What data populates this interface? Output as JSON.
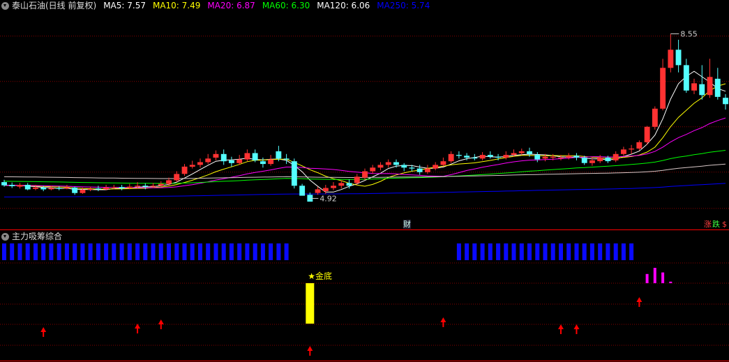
{
  "header": {
    "title": "泰山石油(日线 前复权)",
    "ma": [
      {
        "label": "MA5: 7.57",
        "color": "#ffffff"
      },
      {
        "label": "MA10: 7.49",
        "color": "#ffff00"
      },
      {
        "label": "MA20: 6.87",
        "color": "#ff00ff"
      },
      {
        "label": "MA60: 6.30",
        "color": "#00ff00"
      },
      {
        "label": "MA120: 6.06",
        "color": "#ffffff"
      },
      {
        "label": "MA250: 5.74",
        "color": "#0000ff"
      }
    ]
  },
  "indicator": {
    "title": "主力吸筹综合",
    "signal_label": "★金底"
  },
  "badges": {
    "cai": "财",
    "zhang": "涨",
    "die": "跌",
    "dollar": "$"
  },
  "colors": {
    "up": "#ff3232",
    "down": "#54ffff",
    "grid": "#880000",
    "axis": "#ff0000",
    "blue_bar": "#0a0aff",
    "signal": "#ffff00",
    "magenta": "#ff00ff",
    "arrow": "#ff0000"
  },
  "chart_data": [
    {
      "type": "candlestick",
      "title": "泰山石油(日线 前复权)",
      "price_range": [
        4.45,
        9.05
      ],
      "price_gridlines": [
        8.5,
        7.5,
        6.5,
        5.5,
        4.7
      ],
      "high_label": "8.55",
      "low_label": "4.92",
      "candles": [
        [
          5.28,
          5.21,
          5.33,
          5.18
        ],
        [
          5.22,
          5.19,
          5.27,
          5.15
        ],
        [
          5.18,
          5.22,
          5.26,
          5.14
        ],
        [
          5.22,
          5.12,
          5.26,
          5.1
        ],
        [
          5.13,
          5.16,
          5.22,
          5.1
        ],
        [
          5.16,
          5.12,
          5.2,
          5.08
        ],
        [
          5.12,
          5.15,
          5.2,
          5.1
        ],
        [
          5.15,
          5.13,
          5.19,
          5.1
        ],
        [
          5.14,
          5.16,
          5.22,
          5.12
        ],
        [
          5.16,
          5.04,
          5.18,
          5.0
        ],
        [
          5.04,
          5.11,
          5.16,
          5.02
        ],
        [
          5.11,
          5.13,
          5.18,
          5.08
        ],
        [
          5.14,
          5.12,
          5.2,
          5.08
        ],
        [
          5.12,
          5.16,
          5.22,
          5.1
        ],
        [
          5.16,
          5.17,
          5.22,
          5.12
        ],
        [
          5.17,
          5.14,
          5.22,
          5.1
        ],
        [
          5.15,
          5.18,
          5.24,
          5.12
        ],
        [
          5.18,
          5.2,
          5.28,
          5.14
        ],
        [
          5.2,
          5.18,
          5.25,
          5.12
        ],
        [
          5.18,
          5.2,
          5.26,
          5.15
        ],
        [
          5.2,
          5.24,
          5.3,
          5.17
        ],
        [
          5.24,
          5.32,
          5.38,
          5.2
        ],
        [
          5.32,
          5.46,
          5.52,
          5.28
        ],
        [
          5.46,
          5.62,
          5.68,
          5.42
        ],
        [
          5.62,
          5.66,
          5.75,
          5.58
        ],
        [
          5.66,
          5.72,
          5.8,
          5.6
        ],
        [
          5.72,
          5.8,
          5.9,
          5.68
        ],
        [
          5.82,
          5.9,
          5.98,
          5.76
        ],
        [
          5.9,
          5.74,
          6.0,
          5.66
        ],
        [
          5.76,
          5.7,
          5.84,
          5.62
        ],
        [
          5.7,
          5.78,
          5.88,
          5.66
        ],
        [
          5.78,
          5.92,
          6.0,
          5.74
        ],
        [
          5.92,
          5.76,
          6.0,
          5.72
        ],
        [
          5.74,
          5.68,
          5.82,
          5.6
        ],
        [
          5.68,
          5.78,
          5.88,
          5.64
        ],
        [
          5.96,
          5.8,
          6.08,
          5.74
        ],
        [
          5.8,
          5.78,
          5.9,
          5.68
        ],
        [
          5.74,
          5.2,
          5.8,
          5.14
        ],
        [
          5.2,
          4.98,
          5.24,
          5.0
        ],
        [
          5.0,
          4.85,
          5.05,
          4.92
        ],
        [
          5.04,
          5.12,
          5.18,
          5.0
        ],
        [
          5.08,
          5.15,
          5.22,
          5.02
        ],
        [
          5.15,
          5.2,
          5.28,
          5.1
        ],
        [
          5.2,
          5.26,
          5.32,
          5.14
        ],
        [
          5.26,
          5.2,
          5.34,
          5.14
        ],
        [
          5.26,
          5.4,
          5.46,
          5.22
        ],
        [
          5.38,
          5.52,
          5.58,
          5.32
        ],
        [
          5.52,
          5.6,
          5.66,
          5.46
        ],
        [
          5.6,
          5.66,
          5.72,
          5.54
        ],
        [
          5.66,
          5.72,
          5.78,
          5.6
        ],
        [
          5.72,
          5.66,
          5.78,
          5.6
        ],
        [
          5.66,
          5.6,
          5.7,
          5.52
        ],
        [
          5.6,
          5.58,
          5.66,
          5.52
        ],
        [
          5.58,
          5.5,
          5.66,
          5.44
        ],
        [
          5.5,
          5.58,
          5.66,
          5.46
        ],
        [
          5.58,
          5.66,
          5.72,
          5.54
        ],
        [
          5.66,
          5.74,
          5.82,
          5.62
        ],
        [
          5.74,
          5.9,
          5.96,
          5.7
        ],
        [
          5.88,
          5.86,
          5.96,
          5.8
        ],
        [
          5.86,
          5.82,
          5.92,
          5.76
        ],
        [
          5.82,
          5.8,
          5.9,
          5.76
        ],
        [
          5.8,
          5.88,
          5.94,
          5.76
        ],
        [
          5.88,
          5.84,
          5.96,
          5.8
        ],
        [
          5.84,
          5.82,
          5.9,
          5.76
        ],
        [
          5.82,
          5.88,
          5.96,
          5.78
        ],
        [
          5.88,
          5.92,
          6.0,
          5.84
        ],
        [
          5.92,
          5.96,
          6.02,
          5.88
        ],
        [
          5.96,
          5.9,
          6.04,
          5.84
        ],
        [
          5.88,
          5.78,
          5.94,
          5.72
        ],
        [
          5.8,
          5.84,
          5.9,
          5.74
        ],
        [
          5.82,
          5.84,
          5.9,
          5.76
        ],
        [
          5.82,
          5.82,
          5.88,
          5.76
        ],
        [
          5.82,
          5.86,
          5.92,
          5.78
        ],
        [
          5.86,
          5.82,
          5.92,
          5.76
        ],
        [
          5.82,
          5.7,
          5.86,
          5.66
        ],
        [
          5.7,
          5.76,
          5.82,
          5.64
        ],
        [
          5.74,
          5.82,
          5.88,
          5.7
        ],
        [
          5.82,
          5.74,
          5.86,
          5.7
        ],
        [
          5.76,
          5.9,
          5.96,
          5.72
        ],
        [
          5.9,
          6.0,
          6.06,
          5.86
        ],
        [
          6.0,
          6.02,
          6.1,
          5.9
        ],
        [
          6.02,
          6.16,
          6.2,
          5.98
        ],
        [
          6.16,
          6.5,
          6.52,
          6.1
        ],
        [
          6.5,
          6.9,
          6.95,
          6.44
        ],
        [
          6.9,
          7.8,
          8.0,
          6.86
        ],
        [
          7.8,
          8.2,
          8.55,
          7.7
        ],
        [
          8.2,
          7.86,
          8.42,
          7.7
        ],
        [
          7.86,
          7.3,
          8.0,
          7.25
        ],
        [
          7.3,
          7.46,
          7.56,
          7.22
        ],
        [
          7.44,
          7.2,
          7.86,
          7.1
        ],
        [
          7.2,
          7.6,
          8.0,
          7.14
        ],
        [
          7.56,
          7.16,
          7.8,
          7.1
        ],
        [
          7.14,
          7.0,
          7.22,
          6.88
        ]
      ]
    },
    {
      "type": "bar",
      "title": "主力吸筹综合",
      "blue_bar_days": [
        0,
        1,
        2,
        3,
        4,
        5,
        6,
        7,
        8,
        9,
        10,
        11,
        12,
        13,
        14,
        15,
        16,
        17,
        18,
        19,
        20,
        21,
        22,
        23,
        24,
        25,
        26,
        27,
        28,
        29,
        30,
        31,
        32,
        33,
        34,
        35,
        36,
        58,
        59,
        60,
        61,
        62,
        63,
        64,
        65,
        66,
        67,
        68,
        69,
        70,
        71,
        72,
        73,
        74,
        75,
        76,
        77,
        78,
        79,
        80
      ],
      "signal_bar_day": 39,
      "magenta_bars": [
        [
          82,
          0.6
        ],
        [
          83,
          1.0
        ],
        [
          84,
          0.7
        ],
        [
          85,
          0.1
        ]
      ],
      "arrow_days": [
        5,
        17,
        20,
        39,
        56,
        71,
        73,
        81
      ]
    }
  ]
}
